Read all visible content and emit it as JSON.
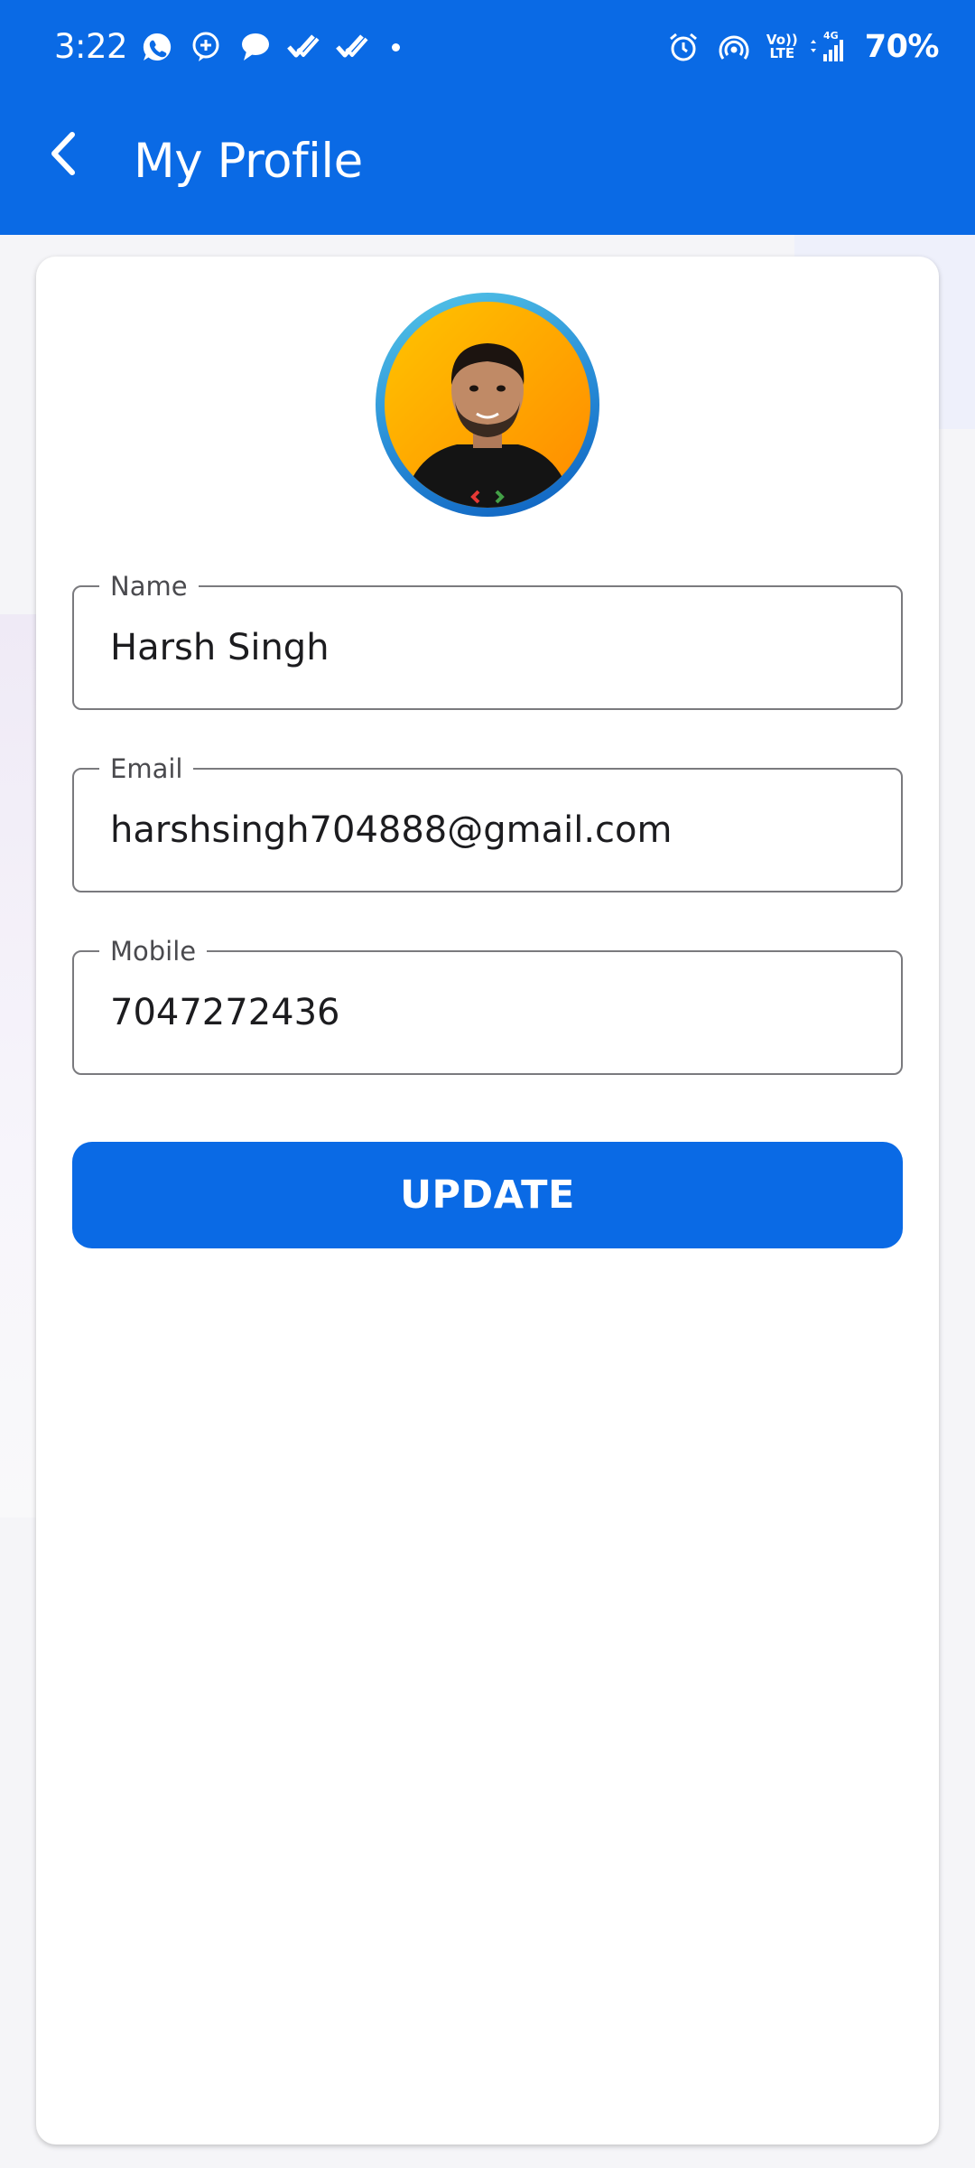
{
  "status_bar": {
    "time": "3:22",
    "notification_icons": [
      "whatsapp-icon",
      "chat-add-icon",
      "message-bubble-icon",
      "double-check-icon",
      "double-check-icon",
      "more-dot-icon"
    ],
    "system_icons": [
      "alarm-icon",
      "hotspot-icon",
      "volte-icon",
      "signal-4g-icon"
    ],
    "volte_line1": "Vo))",
    "volte_line2": "LTE",
    "network_type": "4G",
    "battery": "70%"
  },
  "app_bar": {
    "title": "My Profile",
    "back_icon": "back-arrow-icon"
  },
  "profile": {
    "avatar_icon": "profile-photo",
    "fields": {
      "name": {
        "label": "Name",
        "value": "Harsh Singh"
      },
      "email": {
        "label": "Email",
        "value": "harshsingh704888@gmail.com"
      },
      "mobile": {
        "label": "Mobile",
        "value": "7047272436"
      }
    },
    "update_label": "UPDATE"
  },
  "colors": {
    "primary": "#0a6ae5",
    "background": "#f5f5f8",
    "card": "#ffffff",
    "field_border": "#7a7a7e",
    "text": "#1c1c1f"
  }
}
